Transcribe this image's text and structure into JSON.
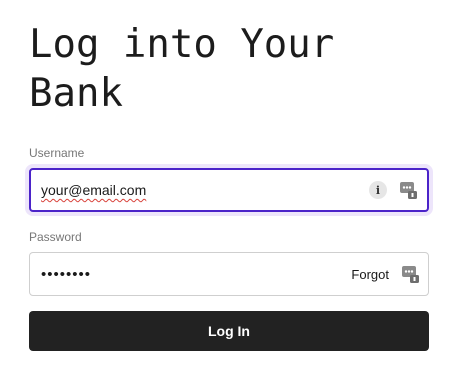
{
  "header": {
    "title": "Log into Your Bank"
  },
  "form": {
    "username": {
      "label": "Username",
      "value": "your@email.com",
      "info_icon": "info-icon",
      "password_manager_icon": "password-manager-icon"
    },
    "password": {
      "label": "Password",
      "value": "••••••••",
      "forgot_label": "Forgot",
      "password_manager_icon": "password-manager-icon"
    },
    "submit_label": "Log In"
  },
  "colors": {
    "focus_border": "#4b23c9",
    "focus_ring": "#ede5fb",
    "button_bg": "#222222",
    "spellcheck_underline": "#d8413a"
  }
}
